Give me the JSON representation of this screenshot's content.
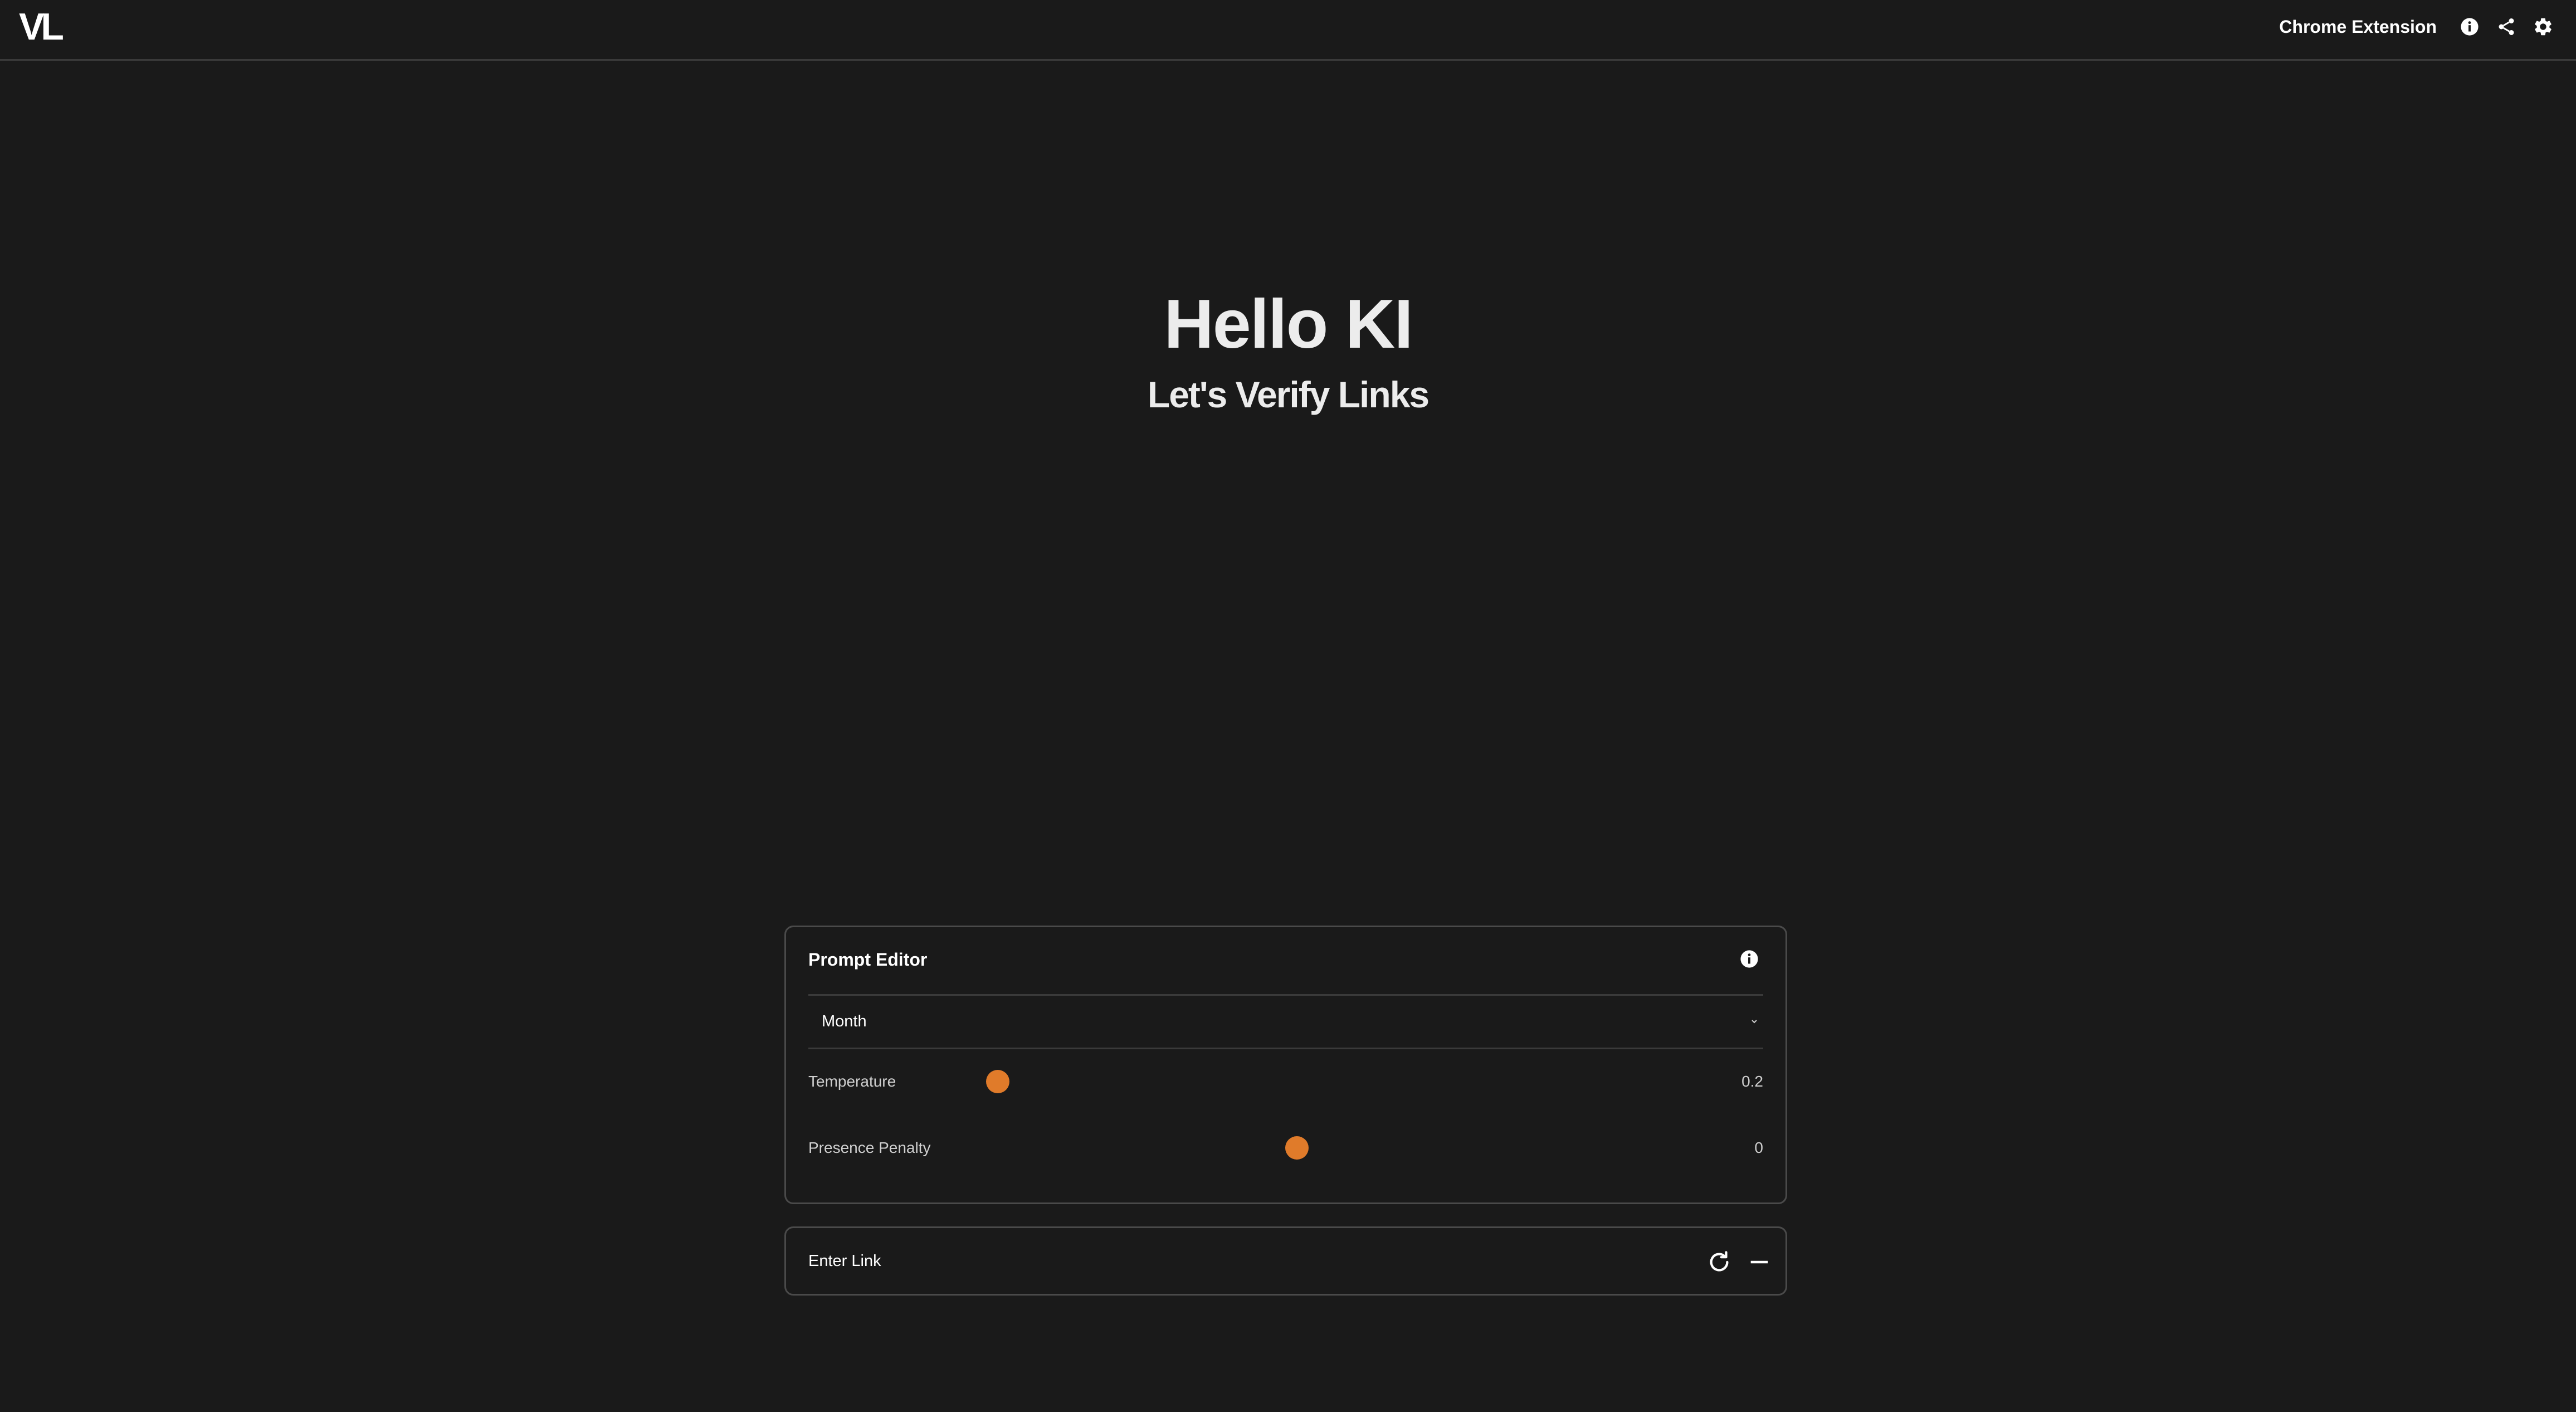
{
  "header": {
    "logo": "VL",
    "extension_link": "Chrome Extension",
    "icons": [
      "info-icon",
      "share-icon",
      "gear-icon"
    ]
  },
  "hero": {
    "title": "Hello KI",
    "subtitle": "Let's Verify Links"
  },
  "prompt_editor": {
    "title": "Prompt Editor",
    "info_icon": "info-icon",
    "select": {
      "value": "Month",
      "chevron_icon": "chevron-down-icon"
    },
    "sliders": [
      {
        "label": "Temperature",
        "value": "0.2",
        "position": 0.0
      },
      {
        "label": "Presence Penalty",
        "value": "0",
        "position": 0.5
      }
    ]
  },
  "link_bar": {
    "placeholder": "Enter Link",
    "refresh_icon": "refresh-icon",
    "minus_icon": "minus-icon"
  },
  "colors": {
    "background": "#1a1a1a",
    "accent": "#e07b2a",
    "border": "#4a4a4a"
  }
}
